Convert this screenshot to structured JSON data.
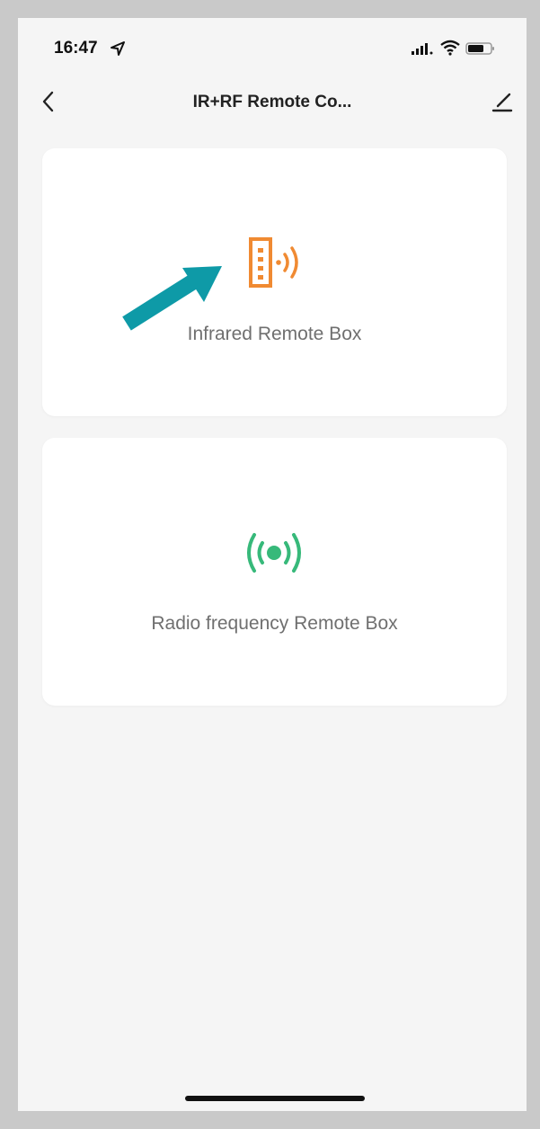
{
  "status_bar": {
    "time": "16:47",
    "icons": [
      "location-arrow-icon",
      "cellular-signal-icon",
      "wifi-icon",
      "battery-icon"
    ]
  },
  "nav": {
    "title": "IR+RF Remote Co...",
    "back_icon": "chevron-left-icon",
    "edit_icon": "pencil-icon"
  },
  "options": [
    {
      "label": "Infrared Remote Box",
      "icon": "infrared-remote-icon",
      "color": "#f08a32"
    },
    {
      "label": "Radio frequency Remote Box",
      "icon": "radio-frequency-icon",
      "color": "#37b97a"
    }
  ],
  "annotation": {
    "icon": "pointer-arrow-icon",
    "color": "#0e9aa7"
  },
  "colors": {
    "background": "#f5f5f5",
    "card": "#ffffff",
    "outer_frame": "#c9c9c9"
  }
}
